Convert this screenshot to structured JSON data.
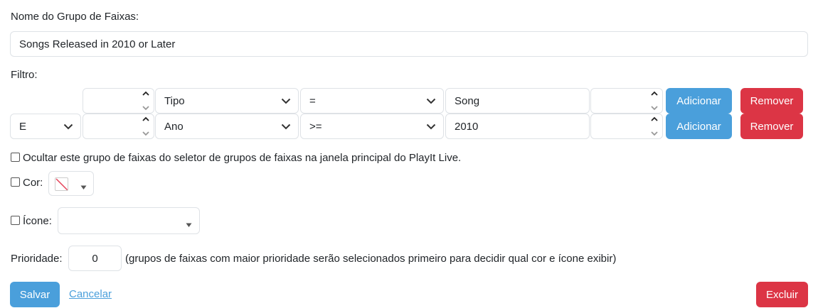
{
  "group_name": {
    "label": "Nome do Grupo de Faixas:",
    "value": "Songs Released in 2010 or Later"
  },
  "filter": {
    "label": "Filtro:",
    "rows": [
      {
        "connector": "",
        "number": "",
        "field": "Tipo",
        "operator": "=",
        "value": "Song",
        "number2": "",
        "add_label": "Adicionar",
        "remove_label": "Remover"
      },
      {
        "connector": "E",
        "number": "",
        "field": "Ano",
        "operator": ">=",
        "value": "2010",
        "number2": "",
        "add_label": "Adicionar",
        "remove_label": "Remover"
      }
    ]
  },
  "hide_option": {
    "checked": false,
    "label": "Ocultar este grupo de faixas do seletor de grupos de faixas na janela principal do PlayIt Live."
  },
  "color_option": {
    "checked": false,
    "label": "Cor:",
    "swatch_icon": "no-color-icon"
  },
  "icon_option": {
    "checked": false,
    "label": "Ícone:",
    "value": ""
  },
  "priority": {
    "label": "Prioridade:",
    "value": "0",
    "hint": "(grupos de faixas com maior prioridade serão selecionados primeiro para decidir qual cor e ícone exibir)"
  },
  "actions": {
    "save_label": "Salvar",
    "cancel_label": "Cancelar",
    "delete_label": "Excluir"
  },
  "colors": {
    "primary": "#4a9fdb",
    "danger": "#dc3545",
    "border": "#dee2e6"
  }
}
